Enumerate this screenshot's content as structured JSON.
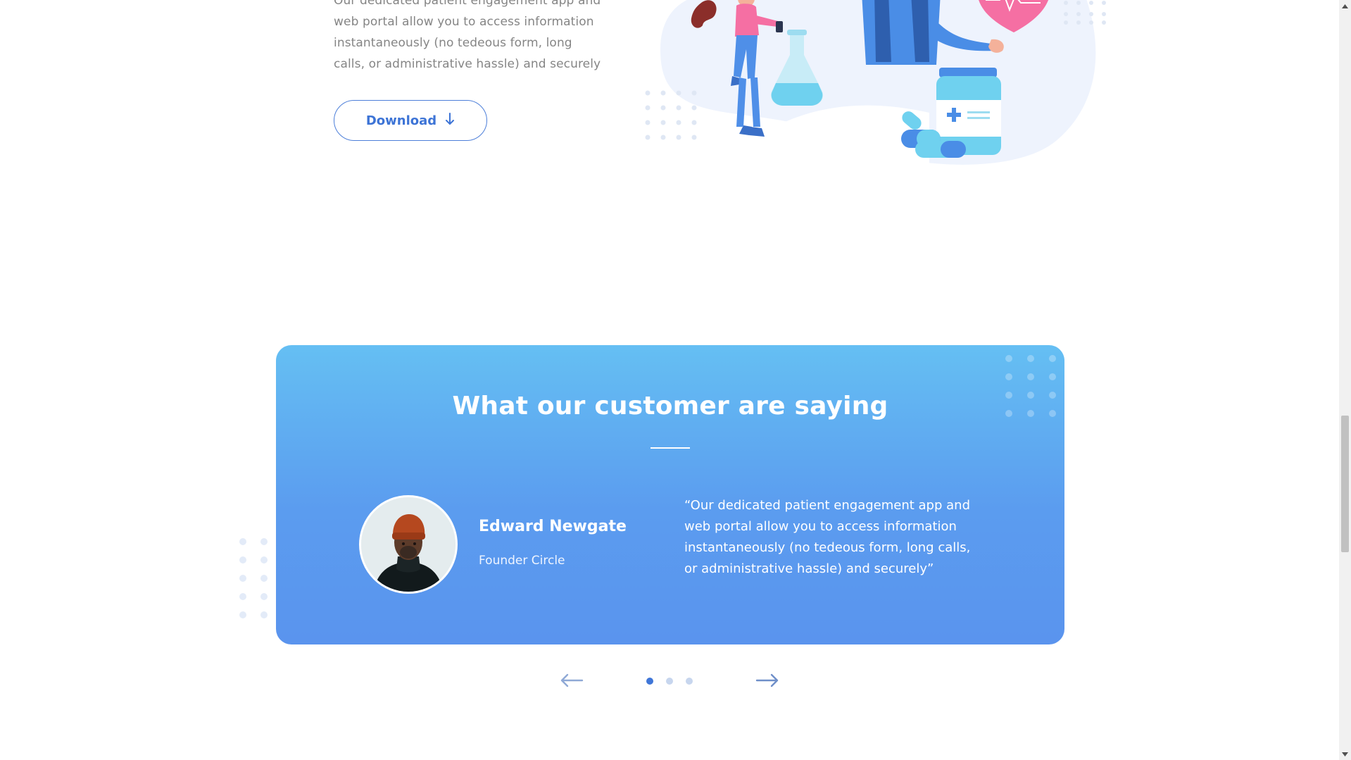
{
  "intro": {
    "text": "Our dedicated patient engagement app and web portal allow you to access information instantaneously (no tedeous form, long calls, or administrative hassle) and securely",
    "download_label": "Download",
    "download_icon": "arrow-down-icon"
  },
  "testimonial": {
    "title": "What our customer are saying",
    "name": "Edward Newgate",
    "role": "Founder Circle",
    "quote": "“Our dedicated patient engagement app and web portal allow you to access information instantaneously (no tedeous form, long calls, or administrative hassle) and securely”"
  },
  "carousel": {
    "prev_icon": "arrow-left-icon",
    "next_icon": "arrow-right-icon",
    "page_count": 3,
    "active_page": 1
  },
  "colors": {
    "accent": "#3d74d6",
    "card_top": "#65bff3",
    "card_bottom": "#5a94ee"
  }
}
